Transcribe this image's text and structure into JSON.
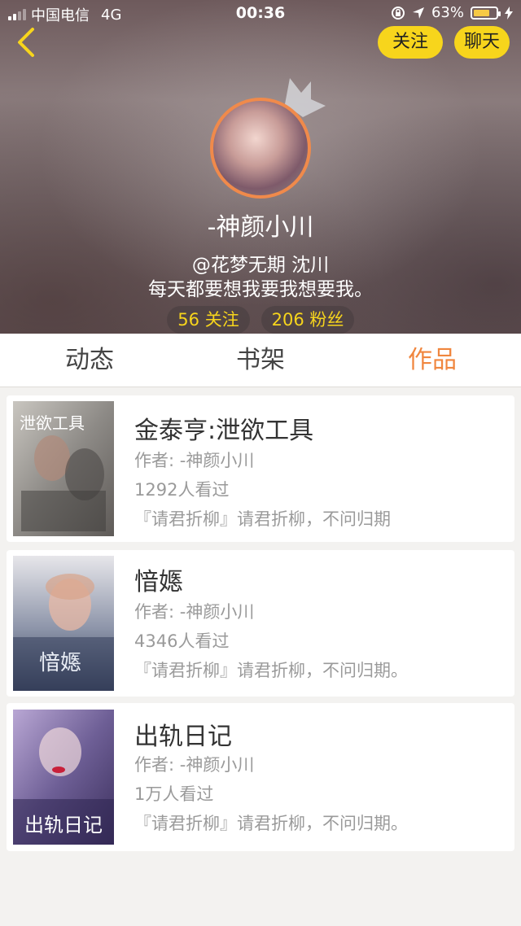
{
  "status_bar": {
    "carrier": "中国电信",
    "network": "4G",
    "time": "00:36",
    "battery_percent": "63%",
    "battery_level": 0.63
  },
  "profile": {
    "nickname": "-神颜小川",
    "handle": "@花梦无期 沈川",
    "bio": "每天都要想我要我想要我。",
    "following_label": "56 关注",
    "fans_label": "206 粉丝",
    "follow_button": "关注",
    "chat_button": "聊天"
  },
  "tabs": [
    {
      "label": "动态",
      "active": false
    },
    {
      "label": "书架",
      "active": false
    },
    {
      "label": "作品",
      "active": true
    }
  ],
  "works": [
    {
      "title": "金泰亨:泄欲工具",
      "author": "作者: -神颜小川",
      "views": "1292人看过",
      "desc": "『请君折柳』请君折柳，不问归期",
      "cover_text": "泄欲工具"
    },
    {
      "title": "愔嫕",
      "author": "作者: -神颜小川",
      "views": "4346人看过",
      "desc": "『请君折柳』请君折柳，不问归期。",
      "cover_text": "愔嫕"
    },
    {
      "title": "出轨日记",
      "author": "作者: -神颜小川",
      "views": "1万人看过",
      "desc": "『请君折柳』请君折柳，不问归期。",
      "cover_text": "出轨日记"
    }
  ],
  "colors": {
    "accent_yellow": "#f7d51c",
    "active_tab": "#f08a3e",
    "avatar_ring": "#f08a4b"
  }
}
